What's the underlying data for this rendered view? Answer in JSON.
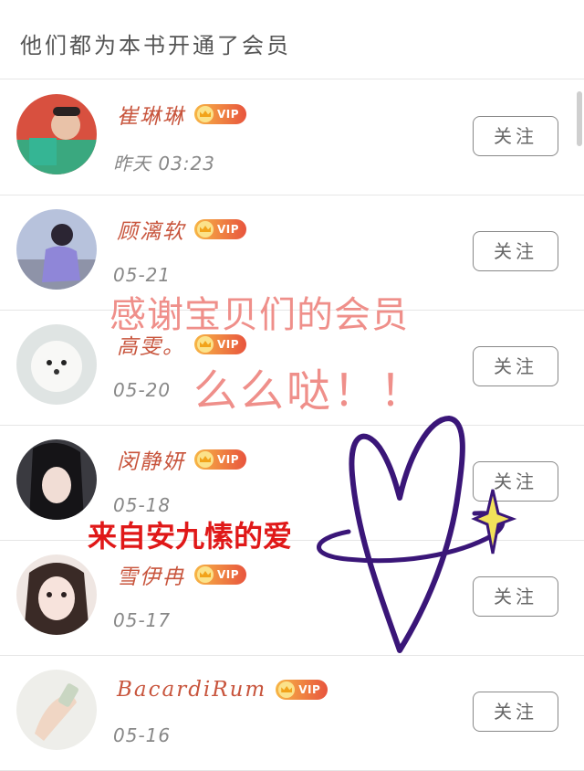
{
  "header": {
    "title": "他们都为本书开通了会员"
  },
  "vip_label": "VIP",
  "follow_label": "关注",
  "members": [
    {
      "name": "崔琳琳",
      "date": "昨天 03:23"
    },
    {
      "name": "顾漓软",
      "date": "05-21"
    },
    {
      "name": "高雯。",
      "date": "05-20"
    },
    {
      "name": "闵静妍",
      "date": "05-18"
    },
    {
      "name": "雪伊冉",
      "date": "05-17"
    },
    {
      "name": "BacardiRum",
      "date": "05-16"
    }
  ],
  "overlay": {
    "line1": "感谢宝贝们的会员",
    "line2": "么么哒！！",
    "line3": "来自安九愫的爱"
  },
  "colors": {
    "name": "#c8553d",
    "overlay_pink": "#ef8f8a",
    "overlay_red": "#e01818",
    "heart": "#3a1678",
    "sparkle": "#f2e25a"
  }
}
